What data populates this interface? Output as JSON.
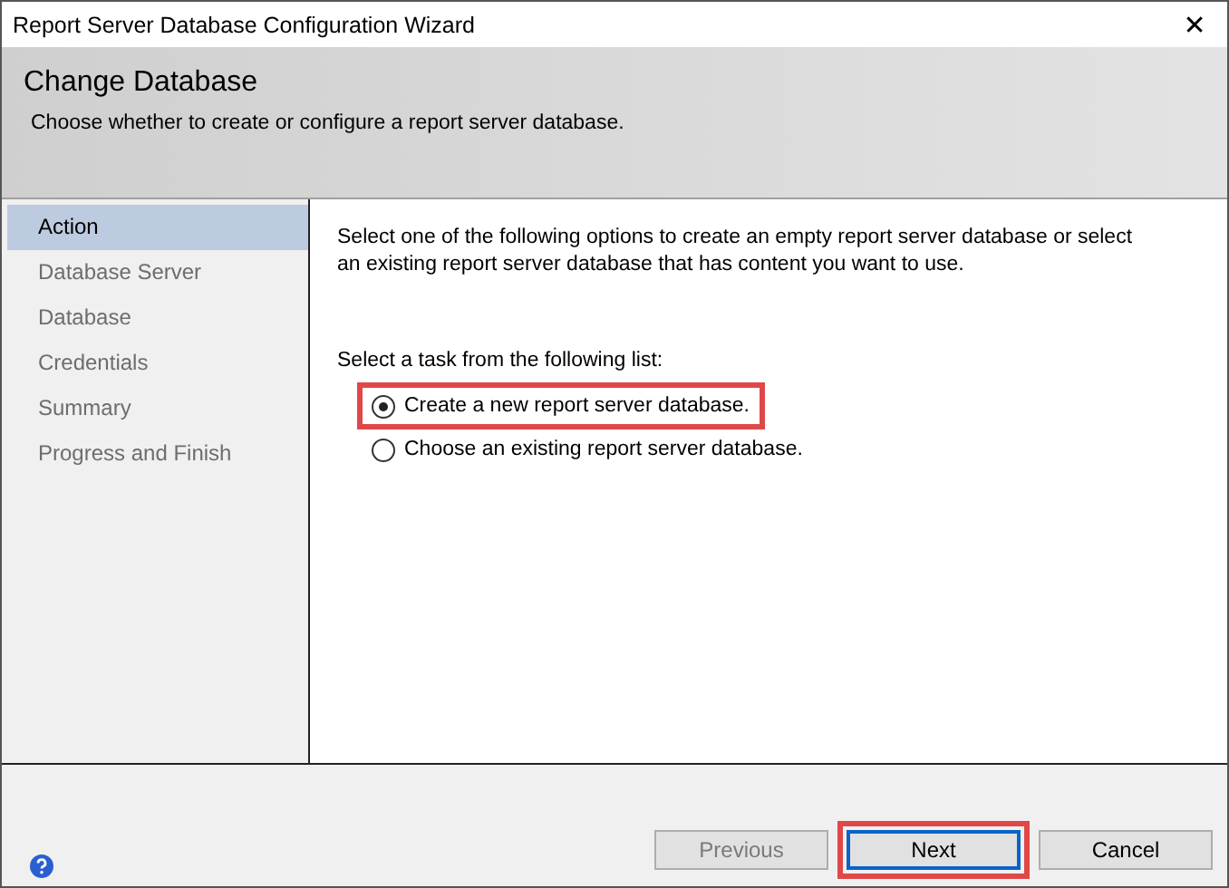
{
  "window": {
    "title": "Report Server Database Configuration Wizard",
    "close": "✕"
  },
  "header": {
    "title": "Change Database",
    "subtitle": "Choose whether to create or configure a report server database."
  },
  "sidebar": {
    "items": [
      {
        "label": "Action",
        "selected": true
      },
      {
        "label": "Database Server",
        "selected": false
      },
      {
        "label": "Database",
        "selected": false
      },
      {
        "label": "Credentials",
        "selected": false
      },
      {
        "label": "Summary",
        "selected": false
      },
      {
        "label": "Progress and Finish",
        "selected": false
      }
    ]
  },
  "content": {
    "intro": "Select one of the following options to create an empty report server database or select an existing report server database that has content you want to use.",
    "task_label": "Select a task from the following list:",
    "options": [
      {
        "label": "Create a new report server database.",
        "selected": true,
        "highlighted": true
      },
      {
        "label": "Choose an existing report server database.",
        "selected": false,
        "highlighted": false
      }
    ]
  },
  "footer": {
    "buttons": [
      {
        "label": "Previous",
        "disabled": true,
        "default": false,
        "highlighted": false
      },
      {
        "label": "Next",
        "disabled": false,
        "default": true,
        "highlighted": true
      },
      {
        "label": "Cancel",
        "disabled": false,
        "default": false,
        "highlighted": false
      }
    ]
  }
}
